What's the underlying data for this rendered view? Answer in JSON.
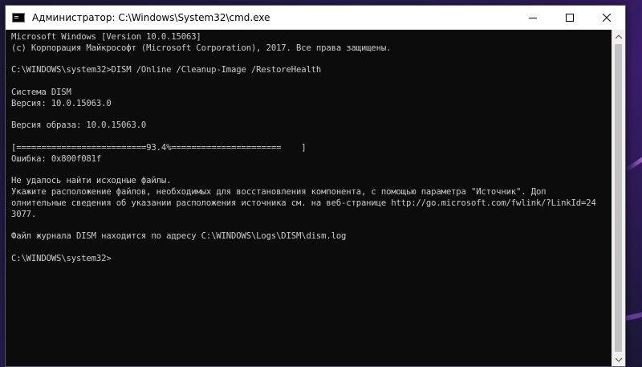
{
  "window": {
    "title": "Администратор: C:\\Windows\\System32\\cmd.exe"
  },
  "controls": {
    "minimize": "minimize-icon",
    "maximize": "maximize-icon",
    "close": "close-icon"
  },
  "console": {
    "lines": [
      "Microsoft Windows [Version 10.0.15063]",
      "(c) Корпорация Майкрософт (Microsoft Corporation), 2017. Все права защищены.",
      "",
      "C:\\WINDOWS\\system32>DISM /Online /Cleanup-Image /RestoreHealth",
      "",
      "Система DISM",
      "Версия: 10.0.15063.0",
      "",
      "Версия образа: 10.0.15063.0",
      "",
      "[==========================93.4%======================    ]",
      "Ошибка: 0x800f081f",
      "",
      "Не удалось найти исходные файлы.",
      "Укажите расположение файлов, необходимых для восстановления компонента, с помощью параметра \"Источник\". Доп",
      "олнительные сведения об указании расположения источника см. на веб-странице http://go.microsoft.com/fwlink/?LinkId=24",
      "3077.",
      "",
      "Файл журнала DISM находится по адресу C:\\WINDOWS\\Logs\\DISM\\dism.log",
      "",
      "C:\\WINDOWS\\system32>"
    ]
  },
  "colors": {
    "console_bg": "#0c0c0c",
    "console_text": "#cccccc",
    "titlebar_bg": "#ffffff"
  }
}
